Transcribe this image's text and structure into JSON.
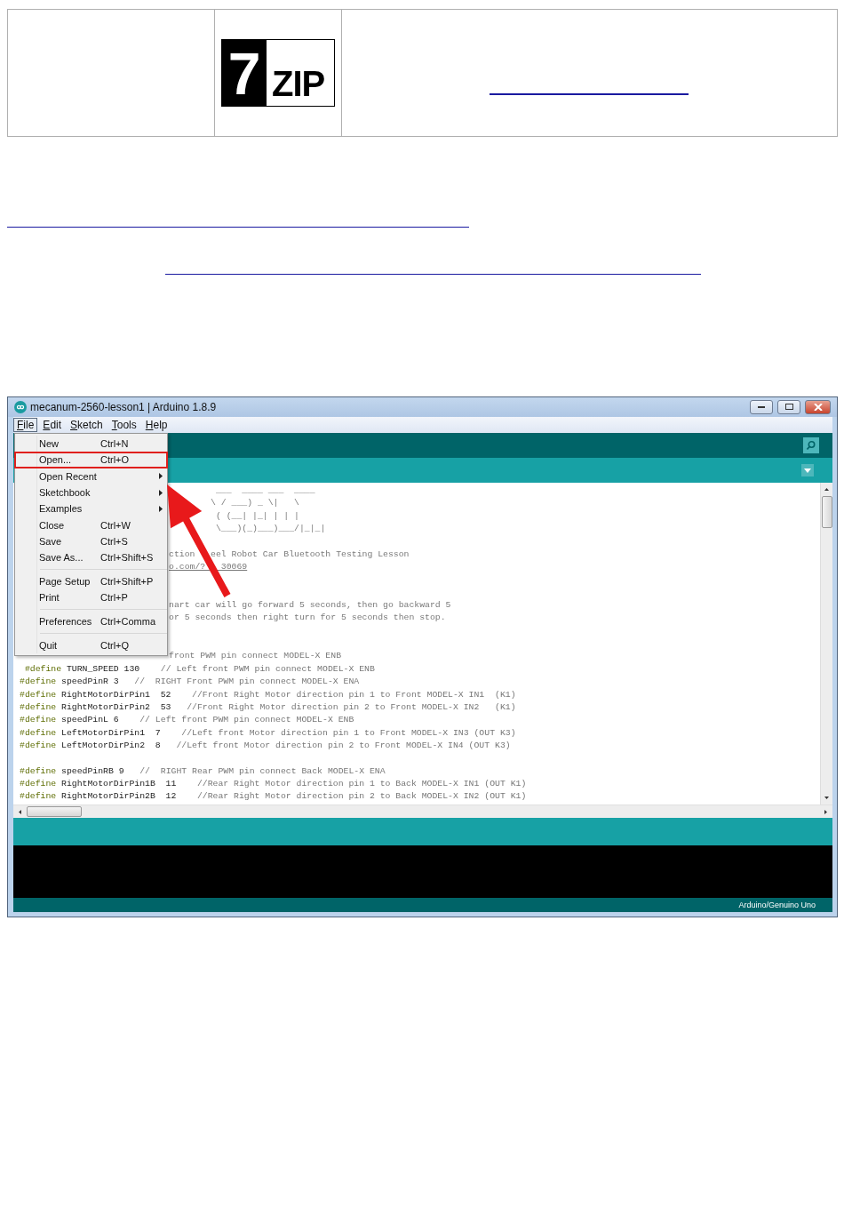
{
  "table": {
    "cells": [
      {
        "kind": "empty"
      },
      {
        "kind": "logo",
        "logo": {
          "digit": "7",
          "word": "ZIP"
        }
      },
      {
        "kind": "link"
      }
    ]
  },
  "links": [
    {
      "kind": "link"
    },
    {
      "kind": "indented_link"
    }
  ],
  "window": {
    "title": "mecanum-2560-lesson1 | Arduino 1.8.9",
    "menu_bar": [
      {
        "label": "File",
        "selected": true
      },
      {
        "label": "Edit",
        "selected": false
      },
      {
        "label": "Sketch",
        "selected": false
      },
      {
        "label": "Tools",
        "selected": false
      },
      {
        "label": "Help",
        "selected": false
      }
    ],
    "file_menu": {
      "items": [
        {
          "kind": "item",
          "label": "New",
          "shortcut": "Ctrl+N",
          "highlighted": false
        },
        {
          "kind": "item",
          "label": "Open...",
          "shortcut": "Ctrl+O",
          "highlighted": true
        },
        {
          "kind": "submenu",
          "label": "Open Recent",
          "highlighted": false
        },
        {
          "kind": "submenu",
          "label": "Sketchbook",
          "highlighted": false
        },
        {
          "kind": "submenu",
          "label": "Examples",
          "highlighted": false
        },
        {
          "kind": "item",
          "label": "Close",
          "shortcut": "Ctrl+W",
          "highlighted": false
        },
        {
          "kind": "item",
          "label": "Save",
          "shortcut": "Ctrl+S",
          "highlighted": false
        },
        {
          "kind": "item",
          "label": "Save As...",
          "shortcut": "Ctrl+Shift+S",
          "highlighted": false
        },
        {
          "kind": "separator"
        },
        {
          "kind": "item",
          "label": "Page Setup",
          "shortcut": "Ctrl+Shift+P",
          "highlighted": false
        },
        {
          "kind": "item",
          "label": "Print",
          "shortcut": "Ctrl+P",
          "highlighted": false
        },
        {
          "kind": "separator"
        },
        {
          "kind": "item",
          "label": "Preferences",
          "shortcut": "Ctrl+Comma",
          "highlighted": false
        },
        {
          "kind": "separator"
        },
        {
          "kind": "item",
          "label": "Quit",
          "shortcut": "Ctrl+Q",
          "highlighted": false
        }
      ]
    },
    "editor": {
      "lines": [
        {
          "kind": "art",
          "text": " ___  ____ ___  ____"
        },
        {
          "kind": "art",
          "text": "\\ / ___) _ \\|   \\"
        },
        {
          "kind": "art",
          "text": " ( (__| |_| | | |"
        },
        {
          "kind": "art",
          "text": " \\___)(_)___)___/|_|_|"
        },
        {
          "kind": "blank"
        },
        {
          "kind": "partial",
          "text": "ction   eel Robot Car Bluetooth Testing Lesson"
        },
        {
          "kind": "partial_link",
          "text": "o.com/?   30069"
        },
        {
          "kind": "blank"
        },
        {
          "kind": "blank"
        },
        {
          "kind": "partial",
          "text": "nart car will go forward 5 seconds, then go backward 5"
        },
        {
          "kind": "partial",
          "text": "or 5 seconds then right turn for 5 seconds then stop."
        },
        {
          "kind": "blank"
        },
        {
          "kind": "blank"
        },
        {
          "kind": "partial",
          "text": "front PWM pin connect MODEL-X ENB"
        },
        {
          "kind": "define",
          "lead": " #define",
          "code": " TURN_SPEED 130",
          "comment": "    // Left front PWM pin connect MODEL-X ENB"
        },
        {
          "kind": "define",
          "lead": "#define",
          "code": " speedPinR 3",
          "comment": "   //  RIGHT Front PWM pin connect MODEL-X ENA"
        },
        {
          "kind": "define",
          "lead": "#define",
          "code": " RightMotorDirPin1  52",
          "comment": "    //Front Right Motor direction pin 1 to Front MODEL-X IN1  (K1)"
        },
        {
          "kind": "define",
          "lead": "#define",
          "code": " RightMotorDirPin2  53",
          "comment": "   //Front Right Motor direction pin 2 to Front MODEL-X IN2   (K1)"
        },
        {
          "kind": "define",
          "lead": "#define",
          "code": " speedPinL 6",
          "comment": "    // Left front PWM pin connect MODEL-X ENB"
        },
        {
          "kind": "define",
          "lead": "#define",
          "code": " LeftMotorDirPin1  7",
          "comment": "    //Left front Motor direction pin 1 to Front MODEL-X IN3 (OUT K3)"
        },
        {
          "kind": "define",
          "lead": "#define",
          "code": " LeftMotorDirPin2  8",
          "comment": "   //Left front Motor direction pin 2 to Front MODEL-X IN4 (OUT K3)"
        },
        {
          "kind": "blank"
        },
        {
          "kind": "define",
          "lead": "#define",
          "code": " speedPinRB 9",
          "comment": "   //  RIGHT Rear PWM pin connect Back MODEL-X ENA"
        },
        {
          "kind": "define",
          "lead": "#define",
          "code": " RightMotorDirPin1B  11",
          "comment": "    //Rear Right Motor direction pin 1 to Back MODEL-X IN1 (OUT K1)"
        },
        {
          "kind": "define",
          "lead": "#define",
          "code": " RightMotorDirPin2B  12",
          "comment": "    //Rear Right Motor direction pin 2 to Back MODEL-X IN2 (OUT K1)"
        }
      ]
    },
    "status_bar": {
      "board": "Arduino/Genuino Uno"
    }
  }
}
